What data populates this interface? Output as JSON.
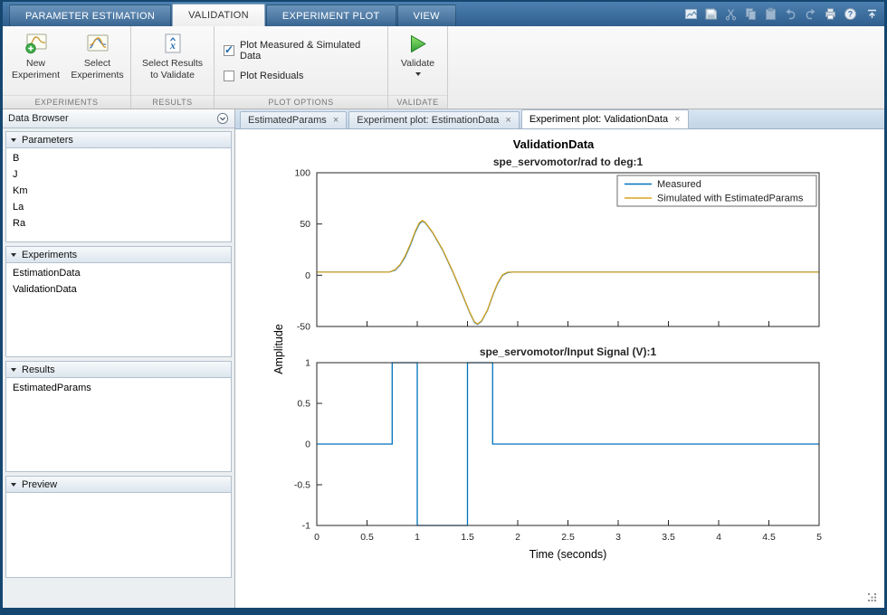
{
  "ribbon_tabs": [
    {
      "label": "PARAMETER ESTIMATION",
      "active": false
    },
    {
      "label": "VALIDATION",
      "active": true
    },
    {
      "label": "EXPERIMENT PLOT",
      "active": false
    },
    {
      "label": "VIEW",
      "active": false
    }
  ],
  "qat_icons": [
    "snapshot-icon",
    "save-icon",
    "cut-icon",
    "copy-icon",
    "paste-icon",
    "undo-icon",
    "redo-icon",
    "print-icon",
    "help-icon",
    "collapse-ribbon-icon"
  ],
  "ribbon": {
    "section_labels": [
      "EXPERIMENTS",
      "RESULTS",
      "PLOT OPTIONS",
      "VALIDATE"
    ],
    "buttons": {
      "new_experiment": "New\nExperiment",
      "select_experiments": "Select\nExperiments",
      "select_results_to_validate": "Select Results\nto Validate",
      "validate": "Validate"
    },
    "checkboxes": [
      {
        "label": "Plot Measured & Simulated Data",
        "checked": true
      },
      {
        "label": "Plot Residuals",
        "checked": false
      }
    ]
  },
  "sidebar": {
    "title": "Data Browser",
    "sections": [
      {
        "label": "Parameters",
        "items": [
          "B",
          "J",
          "Km",
          "La",
          "Ra"
        ]
      },
      {
        "label": "Experiments",
        "items": [
          "EstimationData",
          "ValidationData"
        ]
      },
      {
        "label": "Results",
        "items": [
          "EstimatedParams"
        ]
      },
      {
        "label": "Preview",
        "items": []
      }
    ]
  },
  "doc_tabs": [
    {
      "label": "EstimatedParams",
      "active": false
    },
    {
      "label": "Experiment plot: EstimationData",
      "active": false
    },
    {
      "label": "Experiment plot: ValidationData",
      "active": true
    }
  ],
  "ui": {
    "close_glyph": "×"
  },
  "figure": {
    "title": "ValidationData",
    "ylabel": "Amplitude"
  },
  "chart_data": [
    {
      "type": "line",
      "title": "spe_servomotor/rad to deg:1",
      "xlim": [
        0,
        5
      ],
      "ylim": [
        -50,
        100
      ],
      "yticks": [
        -50,
        0,
        50,
        100
      ],
      "xticks": [
        0,
        0.5,
        1,
        1.5,
        2,
        2.5,
        3,
        3.5,
        4,
        4.5,
        5
      ],
      "show_xtick_labels": false,
      "grid": false,
      "legend": {
        "position": "northeast",
        "entries": [
          "Measured",
          "Simulated with EstimatedParams"
        ]
      },
      "series": [
        {
          "name": "Measured",
          "color": "#0072bd",
          "points": [
            [
              0,
              3
            ],
            [
              0.72,
              3
            ],
            [
              0.78,
              5
            ],
            [
              0.83,
              10
            ],
            [
              0.88,
              18
            ],
            [
              0.93,
              29
            ],
            [
              0.98,
              42
            ],
            [
              1.02,
              50
            ],
            [
              1.05,
              53
            ],
            [
              1.08,
              51
            ],
            [
              1.15,
              42
            ],
            [
              1.25,
              25
            ],
            [
              1.35,
              4
            ],
            [
              1.45,
              -19
            ],
            [
              1.52,
              -36
            ],
            [
              1.57,
              -46
            ],
            [
              1.6,
              -48
            ],
            [
              1.64,
              -45
            ],
            [
              1.7,
              -34
            ],
            [
              1.75,
              -20
            ],
            [
              1.8,
              -8
            ],
            [
              1.85,
              0
            ],
            [
              1.9,
              2.6
            ],
            [
              1.95,
              3
            ],
            [
              5,
              3
            ]
          ]
        },
        {
          "name": "Simulated with EstimatedParams",
          "color": "#d9a521",
          "points": [
            [
              0,
              3
            ],
            [
              0.72,
              3
            ],
            [
              0.78,
              5.5
            ],
            [
              0.83,
              10.5
            ],
            [
              0.88,
              19
            ],
            [
              0.93,
              30
            ],
            [
              0.98,
              43
            ],
            [
              1.02,
              51
            ],
            [
              1.05,
              53.5
            ],
            [
              1.08,
              51.5
            ],
            [
              1.15,
              42.5
            ],
            [
              1.25,
              25.5
            ],
            [
              1.35,
              4.5
            ],
            [
              1.45,
              -18.5
            ],
            [
              1.52,
              -35.5
            ],
            [
              1.57,
              -45.5
            ],
            [
              1.6,
              -47.5
            ],
            [
              1.64,
              -44.5
            ],
            [
              1.7,
              -33.5
            ],
            [
              1.75,
              -19.5
            ],
            [
              1.8,
              -7.5
            ],
            [
              1.85,
              0.5
            ],
            [
              1.9,
              3
            ],
            [
              5,
              3
            ]
          ]
        }
      ]
    },
    {
      "type": "line",
      "title": "spe_servomotor/Input Signal (V):1",
      "xlim": [
        0,
        5
      ],
      "ylim": [
        -1,
        1
      ],
      "yticks": [
        -1,
        -0.5,
        0,
        0.5,
        1
      ],
      "xticks": [
        0,
        0.5,
        1,
        1.5,
        2,
        2.5,
        3,
        3.5,
        4,
        4.5,
        5
      ],
      "show_xtick_labels": true,
      "grid": false,
      "xlabel": "Time (seconds)",
      "series": [
        {
          "name": "Input Signal",
          "color": "#0072bd",
          "points": [
            [
              0,
              0
            ],
            [
              0.75,
              0
            ],
            [
              0.75,
              1
            ],
            [
              1,
              1
            ],
            [
              1,
              -1
            ],
            [
              1.5,
              -1
            ],
            [
              1.5,
              1
            ],
            [
              1.75,
              1
            ],
            [
              1.75,
              0
            ],
            [
              5,
              0
            ]
          ]
        }
      ]
    }
  ]
}
